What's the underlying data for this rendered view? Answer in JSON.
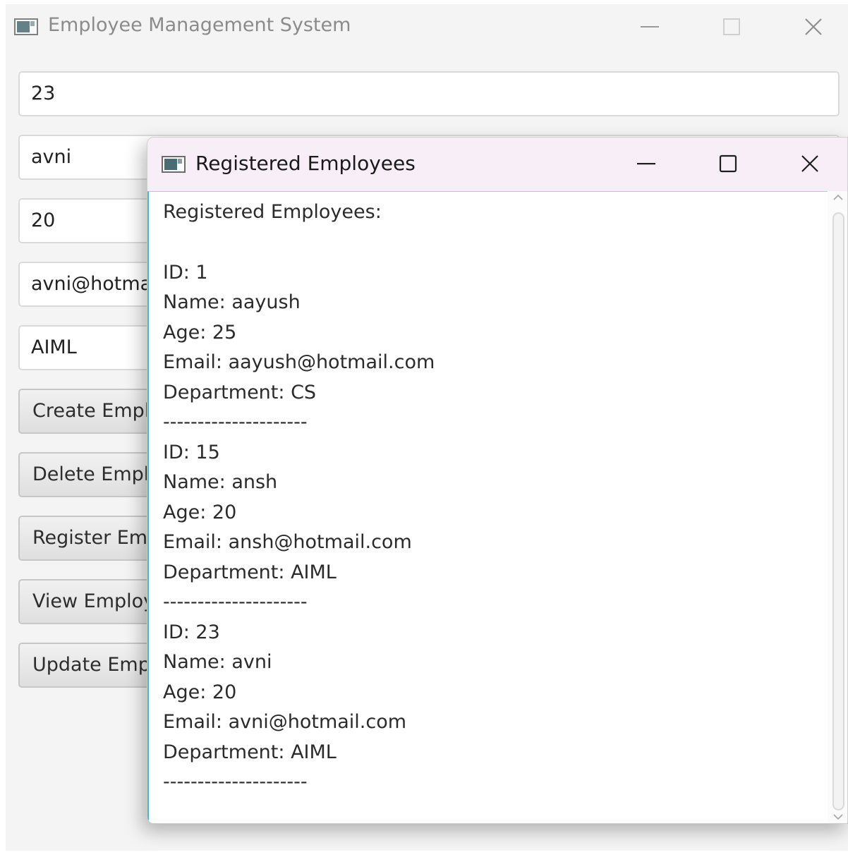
{
  "main_window": {
    "title": "Employee Management System",
    "fields": {
      "id": "23",
      "name": "avni",
      "age": "20",
      "email": "avni@hotmail.com",
      "department": "AIML"
    },
    "buttons": {
      "create": "Create Employee",
      "delete": "Delete Employee",
      "register": "Register Employee",
      "view": "View Employees",
      "update": "Update Employee"
    }
  },
  "popup": {
    "title": "Registered Employees",
    "lines": [
      "Registered Employees:",
      "",
      "ID: 1",
      "Name: aayush",
      "Age: 25",
      "Email: aayush@hotmail.com",
      "Department: CS",
      "---------------------",
      "ID: 15",
      "Name: ansh",
      "Age: 20",
      "Email: ansh@hotmail.com",
      "Department: AIML",
      "---------------------",
      "ID: 23",
      "Name: avni",
      "Age: 20",
      "Email: avni@hotmail.com",
      "Department: AIML",
      "---------------------"
    ]
  }
}
